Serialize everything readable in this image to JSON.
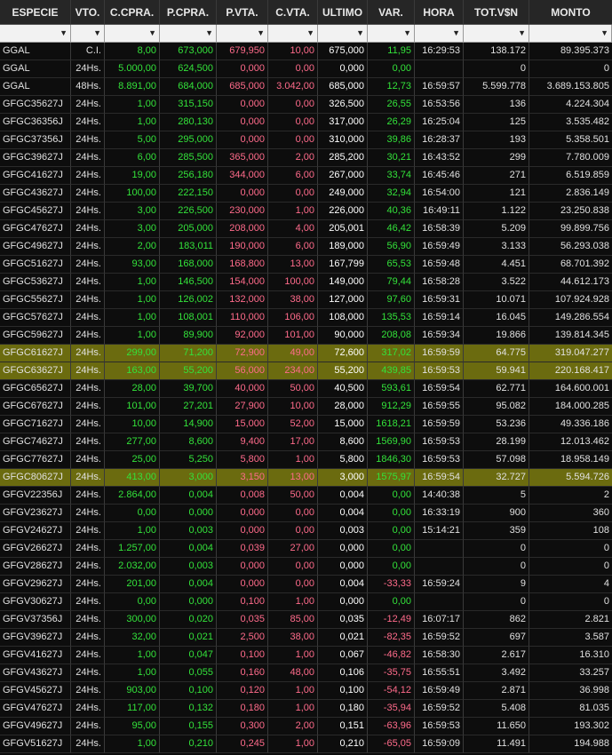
{
  "headers": [
    "ESPECIE",
    "VTO.",
    "C.CPRA.",
    "P.CPRA.",
    "P.VTA.",
    "C.VTA.",
    "ULTIMO",
    "VAR.",
    "HORA",
    "TOT.V$N",
    "MONTO"
  ],
  "filter_icon": "▼",
  "rows": [
    {
      "esp": "GGAL",
      "vto": "C.I.",
      "ccpra": "8,00",
      "pcpra": "673,000",
      "pvta": "679,950",
      "cvta": "10,00",
      "ultimo": "675,000",
      "var": "11,95",
      "hora": "16:29:53",
      "tot": "138.172",
      "monto": "89.395.373",
      "hl": false,
      "neg": false
    },
    {
      "esp": "GGAL",
      "vto": "24Hs.",
      "ccpra": "5.000,00",
      "pcpra": "624,500",
      "pvta": "0,000",
      "cvta": "0,00",
      "ultimo": "0,000",
      "var": "0,00",
      "hora": "",
      "tot": "0",
      "monto": "0",
      "hl": false,
      "neg": false
    },
    {
      "esp": "GGAL",
      "vto": "48Hs.",
      "ccpra": "8.891,00",
      "pcpra": "684,000",
      "pvta": "685,000",
      "cvta": "3.042,00",
      "ultimo": "685,000",
      "var": "12,73",
      "hora": "16:59:57",
      "tot": "5.599.778",
      "monto": "3.689.153.805",
      "hl": false,
      "neg": false
    },
    {
      "esp": "GFGC35627J",
      "vto": "24Hs.",
      "ccpra": "1,00",
      "pcpra": "315,150",
      "pvta": "0,000",
      "cvta": "0,00",
      "ultimo": "326,500",
      "var": "26,55",
      "hora": "16:53:56",
      "tot": "136",
      "monto": "4.224.304",
      "hl": false,
      "neg": false
    },
    {
      "esp": "GFGC36356J",
      "vto": "24Hs.",
      "ccpra": "1,00",
      "pcpra": "280,130",
      "pvta": "0,000",
      "cvta": "0,00",
      "ultimo": "317,000",
      "var": "26,29",
      "hora": "16:25:04",
      "tot": "125",
      "monto": "3.535.482",
      "hl": false,
      "neg": false
    },
    {
      "esp": "GFGC37356J",
      "vto": "24Hs.",
      "ccpra": "5,00",
      "pcpra": "295,000",
      "pvta": "0,000",
      "cvta": "0,00",
      "ultimo": "310,000",
      "var": "39,86",
      "hora": "16:28:37",
      "tot": "193",
      "monto": "5.358.501",
      "hl": false,
      "neg": false
    },
    {
      "esp": "GFGC39627J",
      "vto": "24Hs.",
      "ccpra": "6,00",
      "pcpra": "285,500",
      "pvta": "365,000",
      "cvta": "2,00",
      "ultimo": "285,200",
      "var": "30,21",
      "hora": "16:43:52",
      "tot": "299",
      "monto": "7.780.009",
      "hl": false,
      "neg": false
    },
    {
      "esp": "GFGC41627J",
      "vto": "24Hs.",
      "ccpra": "19,00",
      "pcpra": "256,180",
      "pvta": "344,000",
      "cvta": "6,00",
      "ultimo": "267,000",
      "var": "33,74",
      "hora": "16:45:46",
      "tot": "271",
      "monto": "6.519.859",
      "hl": false,
      "neg": false
    },
    {
      "esp": "GFGC43627J",
      "vto": "24Hs.",
      "ccpra": "100,00",
      "pcpra": "222,150",
      "pvta": "0,000",
      "cvta": "0,00",
      "ultimo": "249,000",
      "var": "32,94",
      "hora": "16:54:00",
      "tot": "121",
      "monto": "2.836.149",
      "hl": false,
      "neg": false
    },
    {
      "esp": "GFGC45627J",
      "vto": "24Hs.",
      "ccpra": "3,00",
      "pcpra": "226,500",
      "pvta": "230,000",
      "cvta": "1,00",
      "ultimo": "226,000",
      "var": "40,36",
      "hora": "16:49:11",
      "tot": "1.122",
      "monto": "23.250.838",
      "hl": false,
      "neg": false
    },
    {
      "esp": "GFGC47627J",
      "vto": "24Hs.",
      "ccpra": "3,00",
      "pcpra": "205,000",
      "pvta": "208,000",
      "cvta": "4,00",
      "ultimo": "205,001",
      "var": "46,42",
      "hora": "16:58:39",
      "tot": "5.209",
      "monto": "99.899.756",
      "hl": false,
      "neg": false
    },
    {
      "esp": "GFGC49627J",
      "vto": "24Hs.",
      "ccpra": "2,00",
      "pcpra": "183,011",
      "pvta": "190,000",
      "cvta": "6,00",
      "ultimo": "189,000",
      "var": "56,90",
      "hora": "16:59:49",
      "tot": "3.133",
      "monto": "56.293.038",
      "hl": false,
      "neg": false
    },
    {
      "esp": "GFGC51627J",
      "vto": "24Hs.",
      "ccpra": "93,00",
      "pcpra": "168,000",
      "pvta": "168,800",
      "cvta": "13,00",
      "ultimo": "167,799",
      "var": "65,53",
      "hora": "16:59:48",
      "tot": "4.451",
      "monto": "68.701.392",
      "hl": false,
      "neg": false
    },
    {
      "esp": "GFGC53627J",
      "vto": "24Hs.",
      "ccpra": "1,00",
      "pcpra": "146,500",
      "pvta": "154,000",
      "cvta": "100,00",
      "ultimo": "149,000",
      "var": "79,44",
      "hora": "16:58:28",
      "tot": "3.522",
      "monto": "44.612.173",
      "hl": false,
      "neg": false
    },
    {
      "esp": "GFGC55627J",
      "vto": "24Hs.",
      "ccpra": "1,00",
      "pcpra": "126,002",
      "pvta": "132,000",
      "cvta": "38,00",
      "ultimo": "127,000",
      "var": "97,60",
      "hora": "16:59:31",
      "tot": "10.071",
      "monto": "107.924.928",
      "hl": false,
      "neg": false
    },
    {
      "esp": "GFGC57627J",
      "vto": "24Hs.",
      "ccpra": "1,00",
      "pcpra": "108,001",
      "pvta": "110,000",
      "cvta": "106,00",
      "ultimo": "108,000",
      "var": "135,53",
      "hora": "16:59:14",
      "tot": "16.045",
      "monto": "149.286.554",
      "hl": false,
      "neg": false
    },
    {
      "esp": "GFGC59627J",
      "vto": "24Hs.",
      "ccpra": "1,00",
      "pcpra": "89,900",
      "pvta": "92,000",
      "cvta": "101,00",
      "ultimo": "90,000",
      "var": "208,08",
      "hora": "16:59:34",
      "tot": "19.866",
      "monto": "139.814.345",
      "hl": false,
      "neg": false
    },
    {
      "esp": "GFGC61627J",
      "vto": "24Hs.",
      "ccpra": "299,00",
      "pcpra": "71,200",
      "pvta": "72,900",
      "cvta": "49,00",
      "ultimo": "72,600",
      "var": "317,02",
      "hora": "16:59:59",
      "tot": "64.775",
      "monto": "319.047.277",
      "hl": true,
      "neg": false
    },
    {
      "esp": "GFGC63627J",
      "vto": "24Hs.",
      "ccpra": "163,00",
      "pcpra": "55,200",
      "pvta": "56,000",
      "cvta": "234,00",
      "ultimo": "55,200",
      "var": "439,85",
      "hora": "16:59:53",
      "tot": "59.941",
      "monto": "220.168.417",
      "hl": true,
      "neg": false
    },
    {
      "esp": "GFGC65627J",
      "vto": "24Hs.",
      "ccpra": "28,00",
      "pcpra": "39,700",
      "pvta": "40,000",
      "cvta": "50,00",
      "ultimo": "40,500",
      "var": "593,61",
      "hora": "16:59:54",
      "tot": "62.771",
      "monto": "164.600.001",
      "hl": false,
      "neg": false
    },
    {
      "esp": "GFGC67627J",
      "vto": "24Hs.",
      "ccpra": "101,00",
      "pcpra": "27,201",
      "pvta": "27,900",
      "cvta": "10,00",
      "ultimo": "28,000",
      "var": "912,29",
      "hora": "16:59:55",
      "tot": "95.082",
      "monto": "184.000.285",
      "hl": false,
      "neg": false
    },
    {
      "esp": "GFGC71627J",
      "vto": "24Hs.",
      "ccpra": "10,00",
      "pcpra": "14,900",
      "pvta": "15,000",
      "cvta": "52,00",
      "ultimo": "15,000",
      "var": "1618,21",
      "hora": "16:59:59",
      "tot": "53.236",
      "monto": "49.336.186",
      "hl": false,
      "neg": false
    },
    {
      "esp": "GFGC74627J",
      "vto": "24Hs.",
      "ccpra": "277,00",
      "pcpra": "8,600",
      "pvta": "9,400",
      "cvta": "17,00",
      "ultimo": "8,600",
      "var": "1569,90",
      "hora": "16:59:53",
      "tot": "28.199",
      "monto": "12.013.462",
      "hl": false,
      "neg": false
    },
    {
      "esp": "GFGC77627J",
      "vto": "24Hs.",
      "ccpra": "25,00",
      "pcpra": "5,250",
      "pvta": "5,800",
      "cvta": "1,00",
      "ultimo": "5,800",
      "var": "1846,30",
      "hora": "16:59:53",
      "tot": "57.098",
      "monto": "18.958.149",
      "hl": false,
      "neg": false
    },
    {
      "esp": "GFGC80627J",
      "vto": "24Hs.",
      "ccpra": "413,00",
      "pcpra": "3,000",
      "pvta": "3,150",
      "cvta": "13,00",
      "ultimo": "3,000",
      "var": "1575,97",
      "hora": "16:59:54",
      "tot": "32.727",
      "monto": "5.594.726",
      "hl": true,
      "neg": false
    },
    {
      "esp": "GFGV22356J",
      "vto": "24Hs.",
      "ccpra": "2.864,00",
      "pcpra": "0,004",
      "pvta": "0,008",
      "cvta": "50,00",
      "ultimo": "0,004",
      "var": "0,00",
      "hora": "14:40:38",
      "tot": "5",
      "monto": "2",
      "hl": false,
      "neg": false
    },
    {
      "esp": "GFGV23627J",
      "vto": "24Hs.",
      "ccpra": "0,00",
      "pcpra": "0,000",
      "pvta": "0,000",
      "cvta": "0,00",
      "ultimo": "0,004",
      "var": "0,00",
      "hora": "16:33:19",
      "tot": "900",
      "monto": "360",
      "hl": false,
      "neg": false
    },
    {
      "esp": "GFGV24627J",
      "vto": "24Hs.",
      "ccpra": "1,00",
      "pcpra": "0,003",
      "pvta": "0,000",
      "cvta": "0,00",
      "ultimo": "0,003",
      "var": "0,00",
      "hora": "15:14:21",
      "tot": "359",
      "monto": "108",
      "hl": false,
      "neg": false
    },
    {
      "esp": "GFGV26627J",
      "vto": "24Hs.",
      "ccpra": "1.257,00",
      "pcpra": "0,004",
      "pvta": "0,039",
      "cvta": "27,00",
      "ultimo": "0,000",
      "var": "0,00",
      "hora": "",
      "tot": "0",
      "monto": "0",
      "hl": false,
      "neg": false
    },
    {
      "esp": "GFGV28627J",
      "vto": "24Hs.",
      "ccpra": "2.032,00",
      "pcpra": "0,003",
      "pvta": "0,000",
      "cvta": "0,00",
      "ultimo": "0,000",
      "var": "0,00",
      "hora": "",
      "tot": "0",
      "monto": "0",
      "hl": false,
      "neg": false
    },
    {
      "esp": "GFGV29627J",
      "vto": "24Hs.",
      "ccpra": "201,00",
      "pcpra": "0,004",
      "pvta": "0,000",
      "cvta": "0,00",
      "ultimo": "0,004",
      "var": "-33,33",
      "hora": "16:59:24",
      "tot": "9",
      "monto": "4",
      "hl": false,
      "neg": true
    },
    {
      "esp": "GFGV30627J",
      "vto": "24Hs.",
      "ccpra": "0,00",
      "pcpra": "0,000",
      "pvta": "0,100",
      "cvta": "1,00",
      "ultimo": "0,000",
      "var": "0,00",
      "hora": "",
      "tot": "0",
      "monto": "0",
      "hl": false,
      "neg": false
    },
    {
      "esp": "GFGV37356J",
      "vto": "24Hs.",
      "ccpra": "300,00",
      "pcpra": "0,020",
      "pvta": "0,035",
      "cvta": "85,00",
      "ultimo": "0,035",
      "var": "-12,49",
      "hora": "16:07:17",
      "tot": "862",
      "monto": "2.821",
      "hl": false,
      "neg": true
    },
    {
      "esp": "GFGV39627J",
      "vto": "24Hs.",
      "ccpra": "32,00",
      "pcpra": "0,021",
      "pvta": "2,500",
      "cvta": "38,00",
      "ultimo": "0,021",
      "var": "-82,35",
      "hora": "16:59:52",
      "tot": "697",
      "monto": "3.587",
      "hl": false,
      "neg": true
    },
    {
      "esp": "GFGV41627J",
      "vto": "24Hs.",
      "ccpra": "1,00",
      "pcpra": "0,047",
      "pvta": "0,100",
      "cvta": "1,00",
      "ultimo": "0,067",
      "var": "-46,82",
      "hora": "16:58:30",
      "tot": "2.617",
      "monto": "16.310",
      "hl": false,
      "neg": true
    },
    {
      "esp": "GFGV43627J",
      "vto": "24Hs.",
      "ccpra": "1,00",
      "pcpra": "0,055",
      "pvta": "0,160",
      "cvta": "48,00",
      "ultimo": "0,106",
      "var": "-35,75",
      "hora": "16:55:51",
      "tot": "3.492",
      "monto": "33.257",
      "hl": false,
      "neg": true
    },
    {
      "esp": "GFGV45627J",
      "vto": "24Hs.",
      "ccpra": "903,00",
      "pcpra": "0,100",
      "pvta": "0,120",
      "cvta": "1,00",
      "ultimo": "0,100",
      "var": "-54,12",
      "hora": "16:59:49",
      "tot": "2.871",
      "monto": "36.998",
      "hl": false,
      "neg": true
    },
    {
      "esp": "GFGV47627J",
      "vto": "24Hs.",
      "ccpra": "117,00",
      "pcpra": "0,132",
      "pvta": "0,180",
      "cvta": "1,00",
      "ultimo": "0,180",
      "var": "-35,94",
      "hora": "16:59:52",
      "tot": "5.408",
      "monto": "81.035",
      "hl": false,
      "neg": true
    },
    {
      "esp": "GFGV49627J",
      "vto": "24Hs.",
      "ccpra": "95,00",
      "pcpra": "0,155",
      "pvta": "0,300",
      "cvta": "2,00",
      "ultimo": "0,151",
      "var": "-63,96",
      "hora": "16:59:53",
      "tot": "11.650",
      "monto": "193.302",
      "hl": false,
      "neg": true
    },
    {
      "esp": "GFGV51627J",
      "vto": "24Hs.",
      "ccpra": "1,00",
      "pcpra": "0,210",
      "pvta": "0,245",
      "cvta": "1,00",
      "ultimo": "0,210",
      "var": "-65,05",
      "hora": "16:59:09",
      "tot": "11.491",
      "monto": "194.988",
      "hl": false,
      "neg": true
    }
  ]
}
